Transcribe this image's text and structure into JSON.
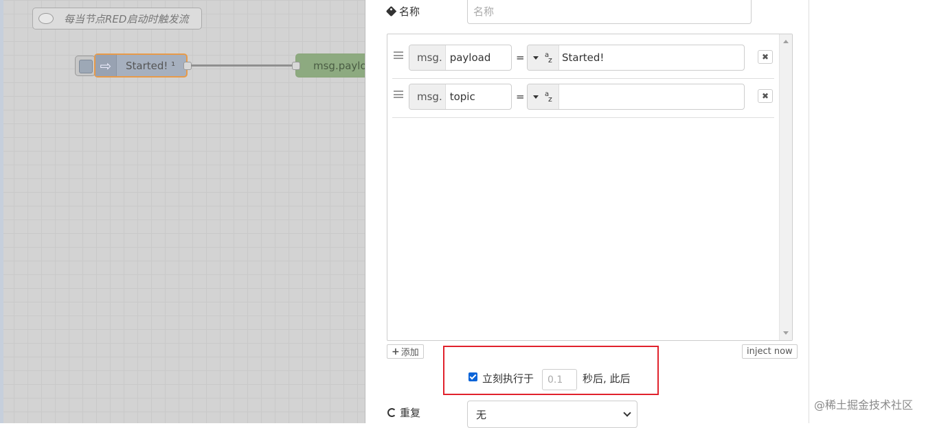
{
  "workspace": {
    "comment_label": "每当节点RED启动时触发流",
    "inject_node_label": "Started! ¹",
    "debug_node_label": "msg.payload"
  },
  "editor": {
    "name_label": "名称",
    "name_placeholder": "名称",
    "properties": [
      {
        "prefix": "msg.",
        "field": "payload",
        "equals": "=",
        "type": "string",
        "value": "Started!"
      },
      {
        "prefix": "msg.",
        "field": "topic",
        "equals": "=",
        "type": "string",
        "value": ""
      }
    ],
    "add_label": "添加",
    "inject_now_label": "inject now",
    "once_checked": true,
    "once_label": "立刻执行于",
    "once_delay_placeholder": "0.1",
    "once_after_label": "秒后, 此后",
    "repeat_label": "重复",
    "repeat_value": "无",
    "remove_symbol": "✖"
  },
  "icons": {
    "name": "tag-icon",
    "repeat": "repeat-icon",
    "type": "string-az-icon"
  },
  "colors": {
    "highlight": "#e0202b",
    "inject_border": "#e89a48",
    "checkbox": "#0b64d8"
  },
  "watermark": "@稀土掘金技术社区"
}
